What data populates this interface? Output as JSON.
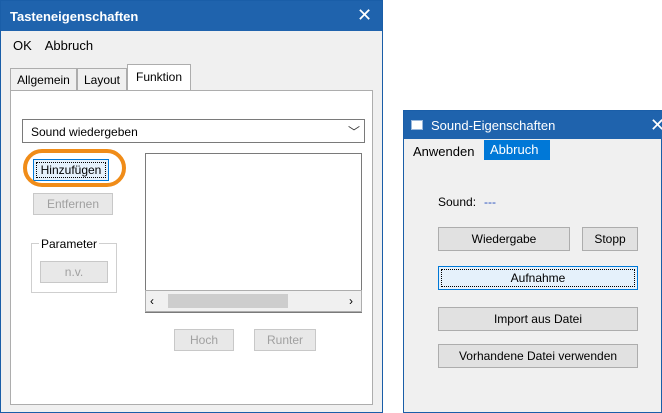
{
  "dialog1": {
    "title": "Tasteneigenschaften",
    "menu": {
      "ok": "OK",
      "cancel": "Abbruch"
    },
    "tabs": [
      "Allgemein",
      "Layout",
      "Funktion"
    ],
    "function_select": "Sound wiedergeben",
    "buttons": {
      "add": "Hinzufügen",
      "remove": "Entfernen",
      "up": "Hoch",
      "down": "Runter"
    },
    "parameter": {
      "label": "Parameter",
      "value": "n.v."
    }
  },
  "dialog2": {
    "title": "Sound-Eigenschaften",
    "menu": {
      "apply": "Anwenden",
      "cancel": "Abbruch"
    },
    "sound_label": "Sound:",
    "sound_value": "---",
    "buttons": {
      "play": "Wiedergabe",
      "stop": "Stopp",
      "record": "Aufnahme",
      "import": "Import aus Datei",
      "use_existing": "Vorhandene Datei verwenden"
    }
  },
  "colors": {
    "titlebar": "#1f63ad",
    "highlight": "#0078d7",
    "annotation": "#f08c18"
  }
}
